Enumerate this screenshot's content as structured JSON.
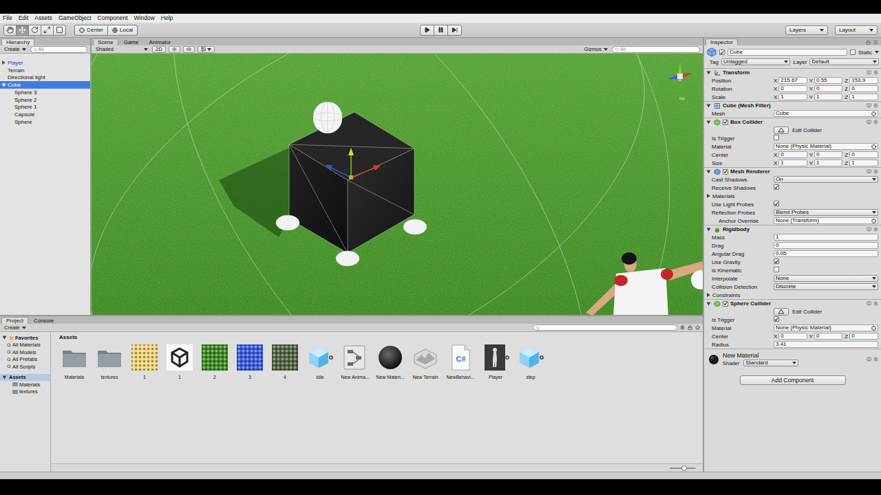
{
  "menu": [
    "File",
    "Edit",
    "Assets",
    "GameObject",
    "Component",
    "Window",
    "Help"
  ],
  "toolbar": {
    "tools": [
      {
        "kind": "hand",
        "selected": false
      },
      {
        "kind": "move",
        "selected": true
      },
      {
        "kind": "rotate",
        "selected": false
      },
      {
        "kind": "scale",
        "selected": false
      },
      {
        "kind": "rect",
        "selected": false
      }
    ],
    "pivot": [
      {
        "kind": "center",
        "label": "Center"
      },
      {
        "kind": "local",
        "label": "Local"
      }
    ],
    "playback": [
      {
        "kind": "play",
        "selected": false
      },
      {
        "kind": "pause",
        "selected": false
      },
      {
        "kind": "step",
        "selected": false
      }
    ],
    "layers": "Layers",
    "layout": "Layout"
  },
  "hierarchy": {
    "title": "Hierarchy",
    "create": "Create",
    "search": "All",
    "items": [
      {
        "label": "Player",
        "prefab": true,
        "expandable": true,
        "expanded": false,
        "selected": false,
        "children": []
      },
      {
        "label": "Terrain",
        "prefab": false,
        "expandable": false,
        "expanded": false,
        "selected": false,
        "children": []
      },
      {
        "label": "Directional light",
        "prefab": false,
        "expandable": false,
        "expanded": false,
        "selected": false,
        "children": []
      },
      {
        "label": "Cube",
        "prefab": false,
        "expandable": true,
        "expanded": true,
        "selected": true,
        "children": [
          {
            "label": "Sphere 3",
            "prefab": false,
            "expandable": false,
            "expanded": false,
            "selected": false,
            "children": []
          },
          {
            "label": "Sphere 2",
            "prefab": false,
            "expandable": false,
            "expanded": false,
            "selected": false,
            "children": []
          },
          {
            "label": "Sphere 1",
            "prefab": false,
            "expandable": false,
            "expanded": false,
            "selected": false,
            "children": []
          },
          {
            "label": "Capsule",
            "prefab": false,
            "expandable": false,
            "expanded": false,
            "selected": false,
            "children": []
          },
          {
            "label": "Sphere",
            "prefab": false,
            "expandable": false,
            "expanded": false,
            "selected": false,
            "children": []
          }
        ]
      }
    ]
  },
  "scene": {
    "tabs": [
      {
        "label": "Scene",
        "selected": true
      },
      {
        "label": "Game",
        "selected": false
      },
      {
        "label": "Animator",
        "selected": false
      }
    ],
    "shading": "Shaded",
    "mode_2d": "2D",
    "gizmos": "Gizmos",
    "search": "All",
    "gizmo_label": "Iso"
  },
  "inspector": {
    "title": "Inspector",
    "object": {
      "name": "Cube",
      "active": true,
      "static_label": "Static",
      "static": false,
      "tag_label": "Tag",
      "tag": "Untagged",
      "layer_label": "Layer",
      "layer": "Default"
    },
    "components": [
      {
        "title": "Transform",
        "kind": "transform",
        "expanded": true,
        "rows": [
          {
            "kind": "vec3",
            "label": "Position",
            "axes": [
              {
                "axis": "X",
                "value": "215.67"
              },
              {
                "axis": "Y",
                "value": "0.55"
              },
              {
                "axis": "Z",
                "value": "153.9"
              }
            ]
          },
          {
            "kind": "vec3",
            "label": "Rotation",
            "axes": [
              {
                "axis": "X",
                "value": "0"
              },
              {
                "axis": "Y",
                "value": "0"
              },
              {
                "axis": "Z",
                "value": "0"
              }
            ]
          },
          {
            "kind": "vec3",
            "label": "Scale",
            "axes": [
              {
                "axis": "X",
                "value": "1"
              },
              {
                "axis": "Y",
                "value": "1"
              },
              {
                "axis": "Z",
                "value": "1"
              }
            ]
          }
        ]
      },
      {
        "title": "Cube (Mesh Filter)",
        "kind": "meshfilter",
        "expanded": true,
        "rows": [
          {
            "kind": "object",
            "label": "Mesh",
            "value": "Cube"
          }
        ]
      },
      {
        "title": "Box Collider",
        "kind": "collider",
        "enabled": true,
        "expanded": true,
        "rows": [
          {
            "kind": "button",
            "label": "Edit Collider"
          },
          {
            "kind": "check",
            "label": "Is Trigger",
            "checked": false
          },
          {
            "kind": "object",
            "label": "Material",
            "value": "None (Physic Material)"
          },
          {
            "kind": "vec3",
            "label": "Center",
            "axes": [
              {
                "axis": "X",
                "value": "0"
              },
              {
                "axis": "Y",
                "value": "0"
              },
              {
                "axis": "Z",
                "value": "0"
              }
            ]
          },
          {
            "kind": "vec3",
            "label": "Size",
            "axes": [
              {
                "axis": "X",
                "value": "1"
              },
              {
                "axis": "Y",
                "value": "1"
              },
              {
                "axis": "Z",
                "value": "1"
              }
            ]
          }
        ]
      },
      {
        "title": "Mesh Renderer",
        "kind": "renderer",
        "enabled": true,
        "expanded": true,
        "rows": [
          {
            "kind": "select",
            "label": "Cast Shadows",
            "value": "On"
          },
          {
            "kind": "check",
            "label": "Receive Shadows",
            "checked": true
          },
          {
            "kind": "fold",
            "label": "Materials",
            "expanded": false
          },
          {
            "kind": "check",
            "label": "Use Light Probes",
            "checked": true
          },
          {
            "kind": "select",
            "label": "Reflection Probes",
            "value": "Blend Probes"
          },
          {
            "kind": "object",
            "label": "Anchor Override",
            "value": "None (Transform)",
            "nested": true
          }
        ]
      },
      {
        "title": "Rigidbody",
        "kind": "rigidbody",
        "expanded": true,
        "rows": [
          {
            "kind": "text",
            "label": "Mass",
            "value": "1"
          },
          {
            "kind": "text",
            "label": "Drag",
            "value": "0"
          },
          {
            "kind": "text",
            "label": "Angular Drag",
            "value": "0.05"
          },
          {
            "kind": "check",
            "label": "Use Gravity",
            "checked": true
          },
          {
            "kind": "check",
            "label": "Is Kinematic",
            "checked": false
          },
          {
            "kind": "select",
            "label": "Interpolate",
            "value": "None"
          },
          {
            "kind": "select",
            "label": "Collision Detection",
            "value": "Discrete"
          },
          {
            "kind": "fold",
            "label": "Constraints",
            "expanded": false
          }
        ]
      },
      {
        "title": "Sphere Collider",
        "kind": "collider",
        "enabled": true,
        "expanded": true,
        "rows": [
          {
            "kind": "button",
            "label": "Edit Collider"
          },
          {
            "kind": "check",
            "label": "Is Trigger",
            "checked": true
          },
          {
            "kind": "object",
            "label": "Material",
            "value": "None (Physic Material)"
          },
          {
            "kind": "vec3",
            "label": "Center",
            "axes": [
              {
                "axis": "X",
                "value": "0"
              },
              {
                "axis": "Y",
                "value": "0"
              },
              {
                "axis": "Z",
                "value": "0"
              }
            ]
          },
          {
            "kind": "text",
            "label": "Radius",
            "value": "3.41"
          }
        ]
      }
    ],
    "material": {
      "name": "New Material",
      "shader_label": "Shader",
      "shader": "Standard"
    },
    "add_component": "Add Component"
  },
  "project": {
    "tabs": [
      {
        "label": "Project",
        "selected": true
      },
      {
        "label": "Console",
        "selected": false
      }
    ],
    "create": "Create",
    "favorites": {
      "label": "Favorites",
      "items": [
        "All Materials",
        "All Models",
        "All Prefabs",
        "All Scripts"
      ]
    },
    "tree": {
      "label": "Assets",
      "selected": true,
      "items": [
        "Materials",
        "textures"
      ]
    },
    "breadcrumb": "Assets",
    "assets": [
      {
        "label": "Materials",
        "kind": "folder"
      },
      {
        "label": "textures",
        "kind": "folder"
      },
      {
        "label": "1",
        "kind": "texture",
        "color": "#f0d67a"
      },
      {
        "label": "1",
        "kind": "scene"
      },
      {
        "label": "2",
        "kind": "texture",
        "color": "#3f8f26"
      },
      {
        "label": "3",
        "kind": "texture",
        "color": "#3c5fe6"
      },
      {
        "label": "4",
        "kind": "texture",
        "color": "#56684a"
      },
      {
        "label": "idle",
        "kind": "prefab"
      },
      {
        "label": "New Anima...",
        "kind": "animator"
      },
      {
        "label": "New Materi...",
        "kind": "material"
      },
      {
        "label": "New Terrain",
        "kind": "terrain"
      },
      {
        "label": "NewBehavi...",
        "kind": "script",
        "badge": "C#"
      },
      {
        "label": "Player",
        "kind": "model"
      },
      {
        "label": "step",
        "kind": "prefab"
      }
    ],
    "icon_size": {
      "level": 0.55
    }
  }
}
